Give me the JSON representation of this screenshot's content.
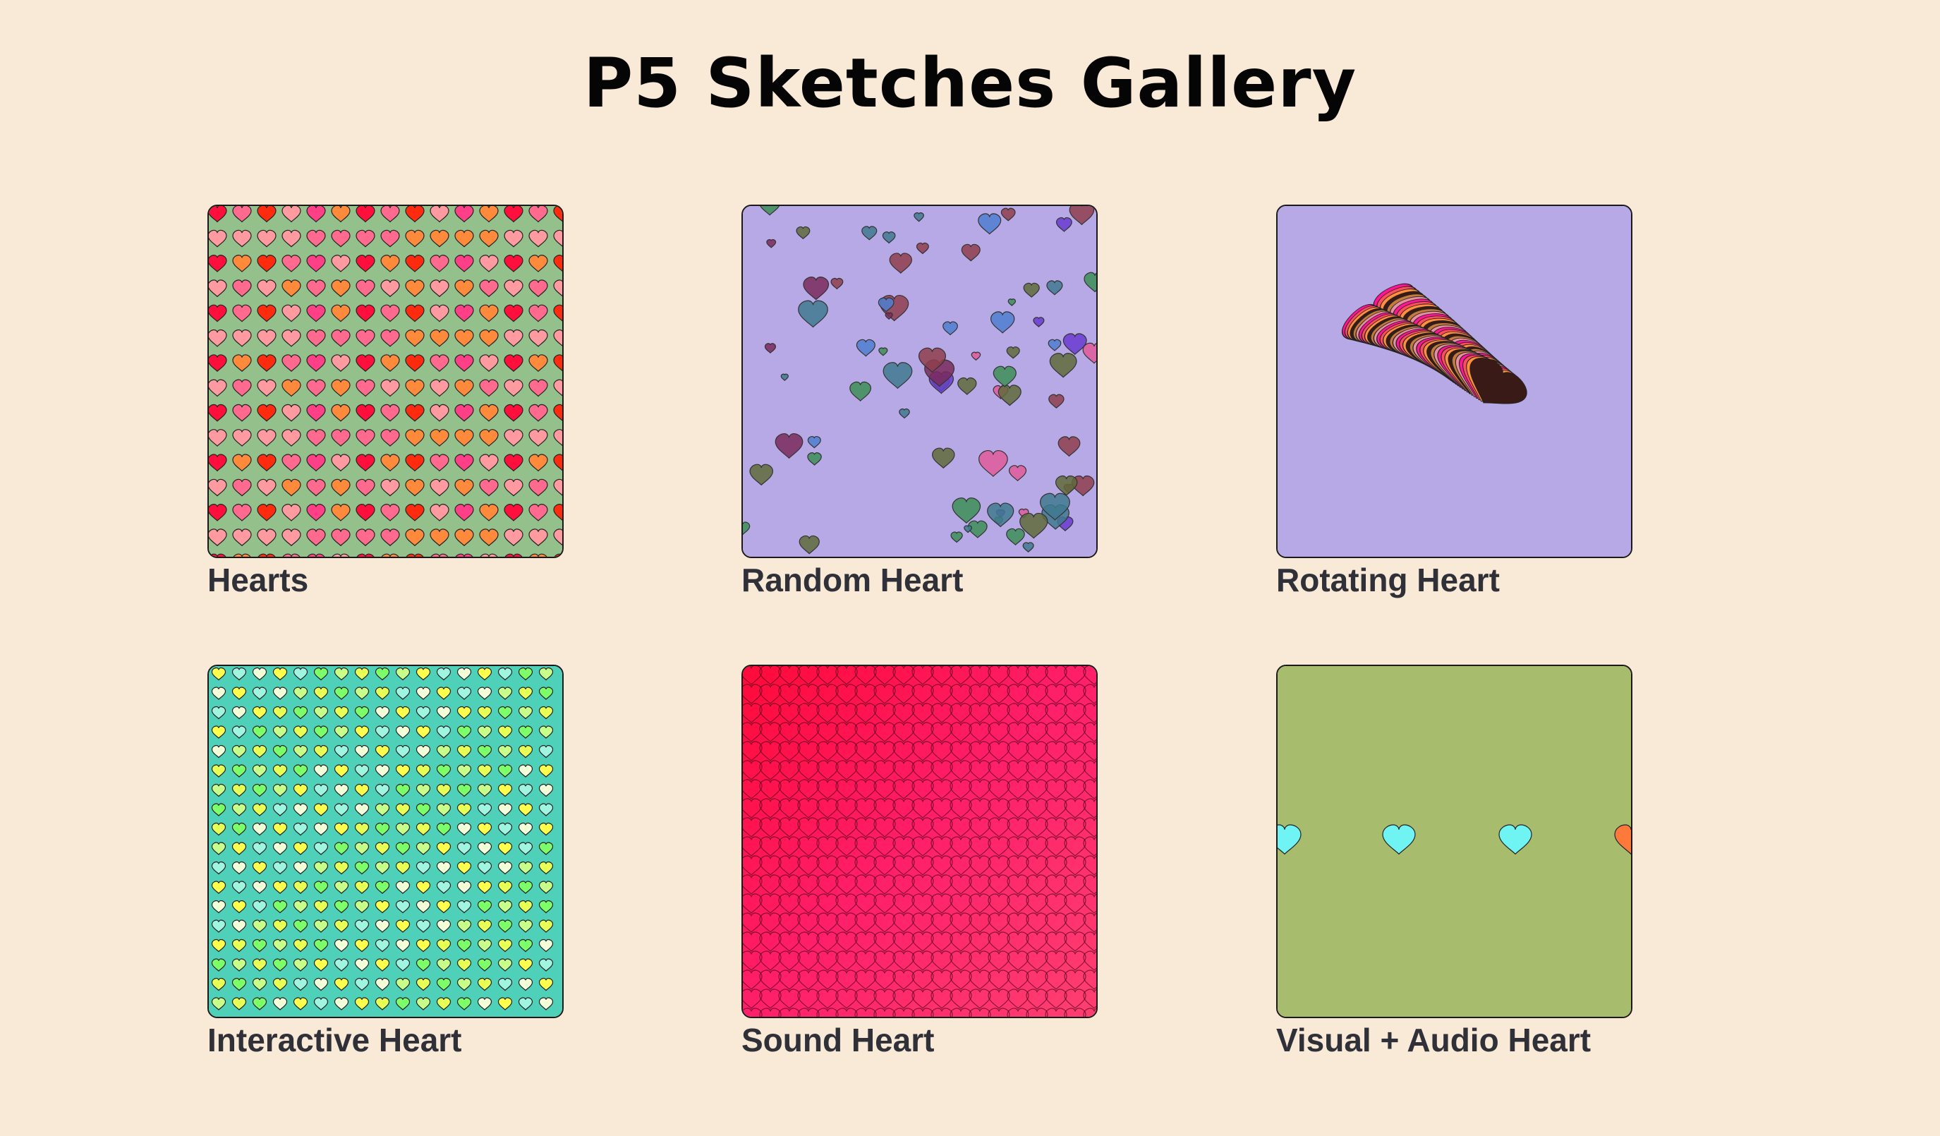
{
  "page": {
    "title": "P5 Sketches Gallery"
  },
  "sketches": [
    {
      "label": "Hearts",
      "background": "#93c08b",
      "palette": [
        "#ff0f3c",
        "#ff8a3b",
        "#ff3f86",
        "#ff9aa1",
        "#ff2b0f",
        "#ff6a8e"
      ]
    },
    {
      "label": "Random Heart",
      "background": "#b7a8e6",
      "palette": [
        "#7a2a5a",
        "#3c8f55",
        "#6a3bcf",
        "#4f7fd0",
        "#8f3e4c",
        "#5f6b3a",
        "#e05a9a",
        "#3f7a8f"
      ]
    },
    {
      "label": "Rotating Heart",
      "background": "#b7a8e6",
      "palette": [
        "#ff1493",
        "#ff4b5c",
        "#ff8f3c",
        "#3a1a16",
        "#c47a3a",
        "#e58fa0"
      ]
    },
    {
      "label": "Interactive Heart",
      "background": "#4fd0b8",
      "palette": [
        "#ffff4d",
        "#c8ff8a",
        "#f3ffd9",
        "#7dff6a",
        "#9ff5e0",
        "#e8ff55"
      ]
    },
    {
      "label": "Sound Heart",
      "background": "#ff1a4a",
      "palette": [
        "#ff0a3a",
        "#ff2a7a",
        "#ff4050",
        "#ff0f8f"
      ]
    },
    {
      "label": "Visual + Audio Heart",
      "background": "#a8bc6e",
      "palette": [
        "#6ff3f3",
        "#6ff3f3",
        "#6ff3f3",
        "#ff7a3a"
      ]
    }
  ]
}
